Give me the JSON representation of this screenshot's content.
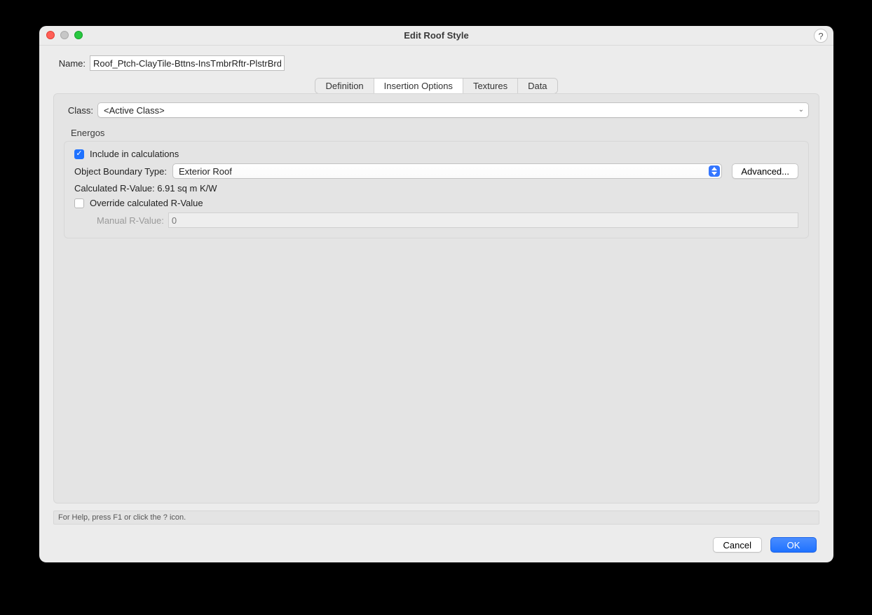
{
  "window": {
    "title": "Edit Roof Style",
    "help_glyph": "?"
  },
  "name": {
    "label": "Name:",
    "value": "Roof_Ptch-ClayTile-Bttns-InsTmbrRftr-PlstrBrd"
  },
  "tabs": [
    {
      "label": "Definition"
    },
    {
      "label": "Insertion Options"
    },
    {
      "label": "Textures"
    },
    {
      "label": "Data"
    }
  ],
  "class": {
    "label": "Class:",
    "value": "<Active Class>"
  },
  "energos": {
    "group_label": "Energos",
    "include_label": "Include in calculations",
    "include_checked": true,
    "obt_label": "Object Boundary Type:",
    "obt_value": "Exterior Roof",
    "advanced_label": "Advanced...",
    "calc_label": "Calculated R-Value: 6.91 sq m K/W",
    "override_label": "Override calculated R-Value",
    "override_checked": false,
    "manual_label": "Manual R-Value:",
    "manual_value": "0"
  },
  "statusbar": "For Help, press F1 or click the ? icon.",
  "footer": {
    "cancel": "Cancel",
    "ok": "OK"
  }
}
